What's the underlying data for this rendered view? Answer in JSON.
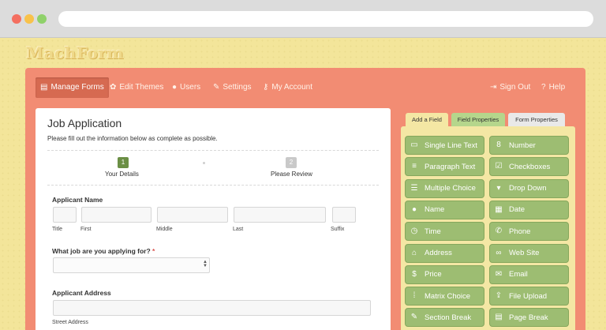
{
  "app": {
    "logo": "MachForm"
  },
  "nav": {
    "items": [
      {
        "label": "Manage Forms",
        "icon": "document-icon"
      },
      {
        "label": "Edit Themes",
        "icon": "palette-icon"
      },
      {
        "label": "Users",
        "icon": "user-icon"
      },
      {
        "label": "Settings",
        "icon": "wrench-icon"
      },
      {
        "label": "My Account",
        "icon": "key-icon"
      }
    ],
    "sign_out": "Sign Out",
    "help": "Help"
  },
  "form": {
    "title": "Job Application",
    "description": "Please fill out the information below as complete as possible.",
    "steps": [
      {
        "number": "1",
        "label": "Your Details"
      },
      {
        "number": "2",
        "label": "Please Review"
      }
    ],
    "applicant_name": {
      "label": "Applicant Name",
      "sublabels": [
        "Title",
        "First",
        "Middle",
        "Last",
        "Suffix"
      ]
    },
    "job_question": {
      "label": "What job are you applying for?",
      "required_mark": "*"
    },
    "address": {
      "label": "Applicant Address",
      "sublabel": "Street Address"
    }
  },
  "panel": {
    "tabs": [
      "Add a Field",
      "Field Properties",
      "Form Properties"
    ],
    "fields": [
      {
        "label": "Single Line Text",
        "icon": "text-line-icon",
        "glyph": "▭"
      },
      {
        "label": "Number",
        "icon": "number-icon",
        "glyph": "8"
      },
      {
        "label": "Paragraph Text",
        "icon": "paragraph-icon",
        "glyph": "≡"
      },
      {
        "label": "Checkboxes",
        "icon": "checkbox-icon",
        "glyph": "☑"
      },
      {
        "label": "Multiple Choice",
        "icon": "list-icon",
        "glyph": "☰"
      },
      {
        "label": "Drop Down",
        "icon": "dropdown-icon",
        "glyph": "▾"
      },
      {
        "label": "Name",
        "icon": "person-icon",
        "glyph": "●"
      },
      {
        "label": "Date",
        "icon": "calendar-icon",
        "glyph": "▦"
      },
      {
        "label": "Time",
        "icon": "clock-icon",
        "glyph": "◷"
      },
      {
        "label": "Phone",
        "icon": "phone-icon",
        "glyph": "✆"
      },
      {
        "label": "Address",
        "icon": "home-icon",
        "glyph": "⌂"
      },
      {
        "label": "Web Site",
        "icon": "link-icon",
        "glyph": "∞"
      },
      {
        "label": "Price",
        "icon": "price-icon",
        "glyph": "$"
      },
      {
        "label": "Email",
        "icon": "envelope-icon",
        "glyph": "✉"
      },
      {
        "label": "Matrix Choice",
        "icon": "matrix-icon",
        "glyph": "⁞"
      },
      {
        "label": "File Upload",
        "icon": "upload-icon",
        "glyph": "⇪"
      },
      {
        "label": "Section Break",
        "icon": "pencil-icon",
        "glyph": "✎"
      },
      {
        "label": "Page Break",
        "icon": "page-icon",
        "glyph": "▤"
      }
    ]
  },
  "colors": {
    "background": "#f3e59a",
    "frame": "#f28c73",
    "active_nav": "#d66a51",
    "field_button": "#9dbd72",
    "step_active": "#6b8f45",
    "step_inactive": "#c9c9c9"
  }
}
